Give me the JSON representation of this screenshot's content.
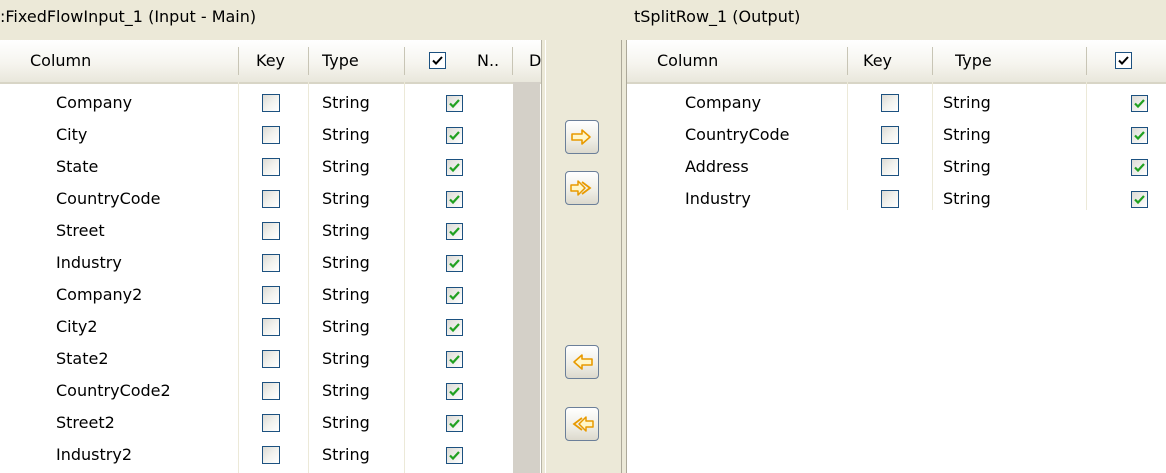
{
  "left": {
    "title": ":FixedFlowInput_1 (Input - Main)",
    "headers": {
      "column": "Column",
      "key": "Key",
      "type": "Type",
      "n": "N..",
      "d": "D"
    },
    "rows": [
      {
        "column": "Company",
        "type": "String",
        "key": false,
        "nullable": true
      },
      {
        "column": "City",
        "type": "String",
        "key": false,
        "nullable": true
      },
      {
        "column": "State",
        "type": "String",
        "key": false,
        "nullable": true
      },
      {
        "column": "CountryCode",
        "type": "String",
        "key": false,
        "nullable": true
      },
      {
        "column": "Street",
        "type": "String",
        "key": false,
        "nullable": true
      },
      {
        "column": "Industry",
        "type": "String",
        "key": false,
        "nullable": true
      },
      {
        "column": "Company2",
        "type": "String",
        "key": false,
        "nullable": true
      },
      {
        "column": "City2",
        "type": "String",
        "key": false,
        "nullable": true
      },
      {
        "column": "State2",
        "type": "String",
        "key": false,
        "nullable": true
      },
      {
        "column": "CountryCode2",
        "type": "String",
        "key": false,
        "nullable": true
      },
      {
        "column": "Street2",
        "type": "String",
        "key": false,
        "nullable": true
      },
      {
        "column": "Industry2",
        "type": "String",
        "key": false,
        "nullable": true
      }
    ]
  },
  "right": {
    "title": "tSplitRow_1 (Output)",
    "headers": {
      "column": "Column",
      "key": "Key",
      "type": "Type"
    },
    "rows": [
      {
        "column": "Company",
        "type": "String",
        "key": false,
        "nullable": true
      },
      {
        "column": "CountryCode",
        "type": "String",
        "key": false,
        "nullable": true
      },
      {
        "column": "Address",
        "type": "String",
        "key": false,
        "nullable": true
      },
      {
        "column": "Industry",
        "type": "String",
        "key": false,
        "nullable": true
      }
    ]
  },
  "buttons": [
    {
      "name": "copy-selected-right-button",
      "icon": "arrow-right-icon"
    },
    {
      "name": "copy-all-right-button",
      "icon": "double-arrow-right-icon"
    },
    {
      "name": "copy-selected-left-button",
      "icon": "arrow-left-icon"
    },
    {
      "name": "copy-all-left-button",
      "icon": "double-arrow-left-icon"
    }
  ],
  "colors": {
    "check": "#21a121",
    "arrow": "#f0a000",
    "border": "#1c5180"
  }
}
